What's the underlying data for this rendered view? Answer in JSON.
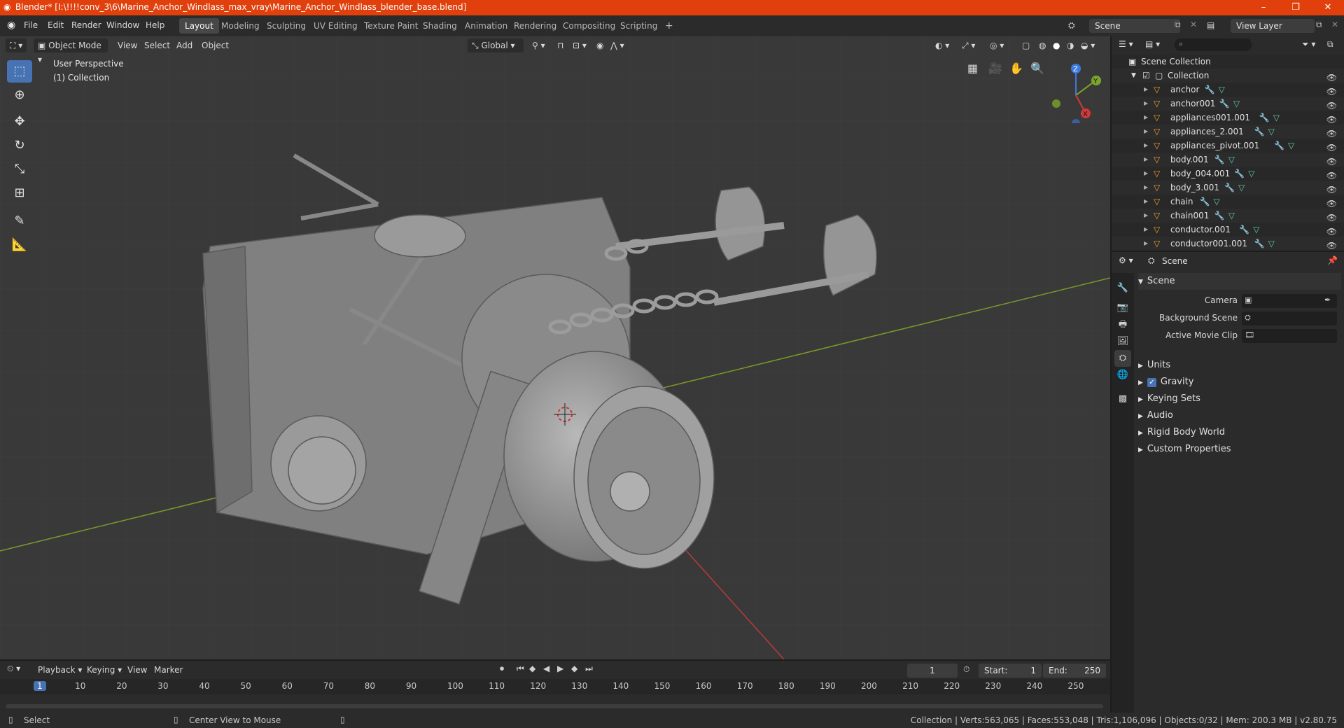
{
  "window": {
    "title": "Blender* [I:\\!!!!conv_3\\6\\Marine_Anchor_Windlass_max_vray\\Marine_Anchor_Windlass_blender_base.blend]",
    "minimize": "–",
    "maximize": "❐",
    "close": "✕"
  },
  "menu": [
    "File",
    "Edit",
    "Render",
    "Window",
    "Help"
  ],
  "workspaces": [
    "Layout",
    "Modeling",
    "Sculpting",
    "UV Editing",
    "Texture Paint",
    "Shading",
    "Animation",
    "Rendering",
    "Compositing",
    "Scripting"
  ],
  "add_workspace": "+",
  "scene_field": "Scene",
  "view_layer_field": "View Layer",
  "viewport": {
    "mode": "Object Mode",
    "menus": [
      "View",
      "Select",
      "Add",
      "Object"
    ],
    "transform_orientation": "Global",
    "perspective_label": "User Perspective",
    "collection_label": "(1) Collection",
    "gizmo": {
      "x": "X",
      "y": "Y",
      "z": "Z"
    }
  },
  "outliner": {
    "root": "Scene Collection",
    "collection": "Collection",
    "items": [
      "anchor",
      "anchor001",
      "appliances001.001",
      "appliances_2.001",
      "appliances_pivot.001",
      "body.001",
      "body_004.001",
      "body_3.001",
      "chain",
      "chain001",
      "conductor.001",
      "conductor001.001"
    ]
  },
  "properties": {
    "header": "Scene",
    "panel": "Scene",
    "camera_label": "Camera",
    "background_scene_label": "Background Scene",
    "active_movie_clip_label": "Active Movie Clip",
    "sections": [
      "Units",
      "Gravity",
      "Keying Sets",
      "Audio",
      "Rigid Body World",
      "Custom Properties"
    ],
    "gravity_checked": true
  },
  "timeline": {
    "menus": [
      "Playback",
      "Keying",
      "View",
      "Marker"
    ],
    "current_frame": "1",
    "start_label": "Start:",
    "start": "1",
    "end_label": "End:",
    "end": "250",
    "ticks": [
      "1",
      "10",
      "20",
      "30",
      "40",
      "50",
      "60",
      "70",
      "80",
      "90",
      "100",
      "110",
      "120",
      "130",
      "140",
      "150",
      "160",
      "170",
      "180",
      "190",
      "200",
      "210",
      "220",
      "230",
      "240",
      "250"
    ]
  },
  "status": {
    "select": "Select",
    "center_view": "Center View to Mouse",
    "stats": "Collection | Verts:563,065 | Faces:553,048 | Tris:1,106,096 | Objects:0/32 | Mem: 200.3 MB | v2.80.75"
  },
  "colors": {
    "accent": "#4772b3",
    "titlebar": "#e1400d",
    "x_axis": "#b83a3a",
    "y_axis": "#7a9a2a"
  }
}
